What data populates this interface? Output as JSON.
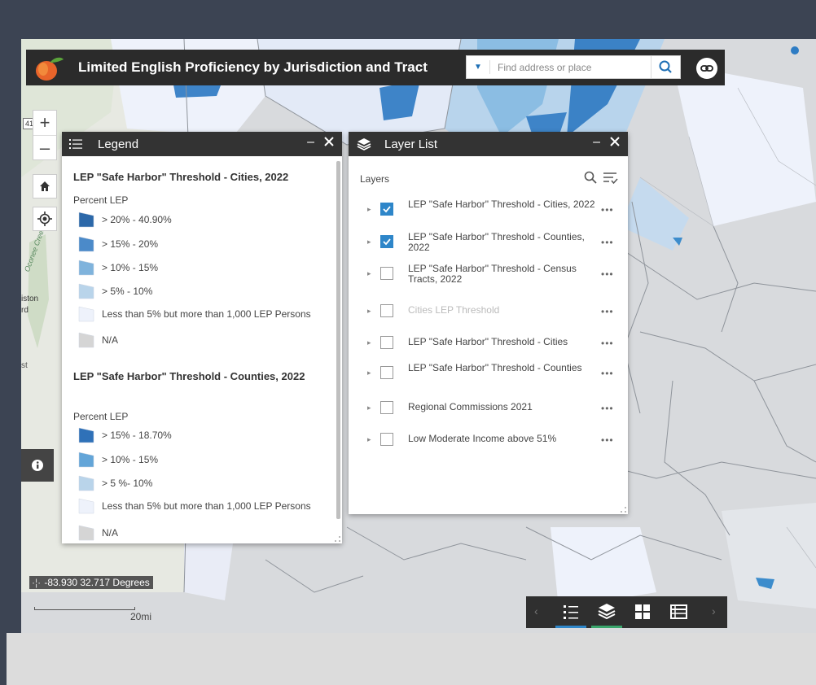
{
  "header": {
    "title": "Limited English Proficiency by Jurisdiction and Tract",
    "search_placeholder": "Find address or place"
  },
  "map_controls": {
    "zoom_in": "+",
    "zoom_out": "–"
  },
  "legend": {
    "title": "Legend",
    "minimize": "–",
    "sections": [
      {
        "title": "LEP \"Safe Harbor\" Threshold - Cities, 2022",
        "subtitle": "Percent LEP",
        "items": [
          {
            "label": "> 20% - 40.90%",
            "color": "#2c68a9"
          },
          {
            "label": "> 15% - 20%",
            "color": "#4b8ac9"
          },
          {
            "label": "> 10% - 15%",
            "color": "#7fb3dc"
          },
          {
            "label": "> 5% - 10%",
            "color": "#b9d4ea"
          },
          {
            "label": "Less than 5% but more than 1,000 LEP Persons",
            "color": "#eef2fb"
          },
          {
            "label": "N/A",
            "color": "#d5d5d5"
          }
        ]
      },
      {
        "title": "LEP \"Safe Harbor\" Threshold - Counties, 2022",
        "subtitle": "Percent LEP",
        "items": [
          {
            "label": "> 15% - 18.70%",
            "color": "#2f71b8"
          },
          {
            "label": "> 10% - 15%",
            "color": "#63a5d8"
          },
          {
            "label": "> 5 %- 10%",
            "color": "#b9d4ea"
          },
          {
            "label": "Less than 5% but more than 1,000 LEP Persons",
            "color": "#eef2fb"
          },
          {
            "label": "N/A",
            "color": "#d5d5d5"
          }
        ]
      }
    ]
  },
  "layer_list": {
    "title": "Layer List",
    "minimize": "–",
    "heading": "Layers",
    "more": "•••",
    "caret": "▸",
    "layers": [
      {
        "label": "LEP \"Safe Harbor\" Threshold - Cities, 2022",
        "checked": true,
        "enabled": true
      },
      {
        "label": "LEP \"Safe Harbor\" Threshold - Counties, 2022",
        "checked": true,
        "enabled": true
      },
      {
        "label": "LEP \"Safe Harbor\" Threshold - Census Tracts, 2022",
        "checked": false,
        "enabled": true
      },
      {
        "label": "Cities LEP Threshold",
        "checked": false,
        "enabled": false
      },
      {
        "label": "LEP \"Safe Harbor\" Threshold - Cities",
        "checked": false,
        "enabled": true
      },
      {
        "label": "LEP \"Safe Harbor\" Threshold - Counties",
        "checked": false,
        "enabled": true
      },
      {
        "label": "Regional Commissions 2021",
        "checked": false,
        "enabled": true
      },
      {
        "label": "Low Moderate Income above 51%",
        "checked": false,
        "enabled": true
      }
    ]
  },
  "status": {
    "coordinates": "-83.930 32.717 Degrees",
    "scale": "20mi"
  },
  "map_labels": {
    "route_41": "41",
    "creek": "Oconee Creek",
    "town1": "iston",
    "town2": "rd",
    "town3": "st"
  },
  "colors": {
    "frame": "#3c4453",
    "panel_header": "#333333",
    "accent_blue": "#2e86c9",
    "map_gray": "#d7d9dc"
  },
  "bottom_toolbar": {
    "prev": "‹",
    "next": "›",
    "items": [
      "legend-icon",
      "layers-icon",
      "grid-icon",
      "table-icon"
    ]
  }
}
